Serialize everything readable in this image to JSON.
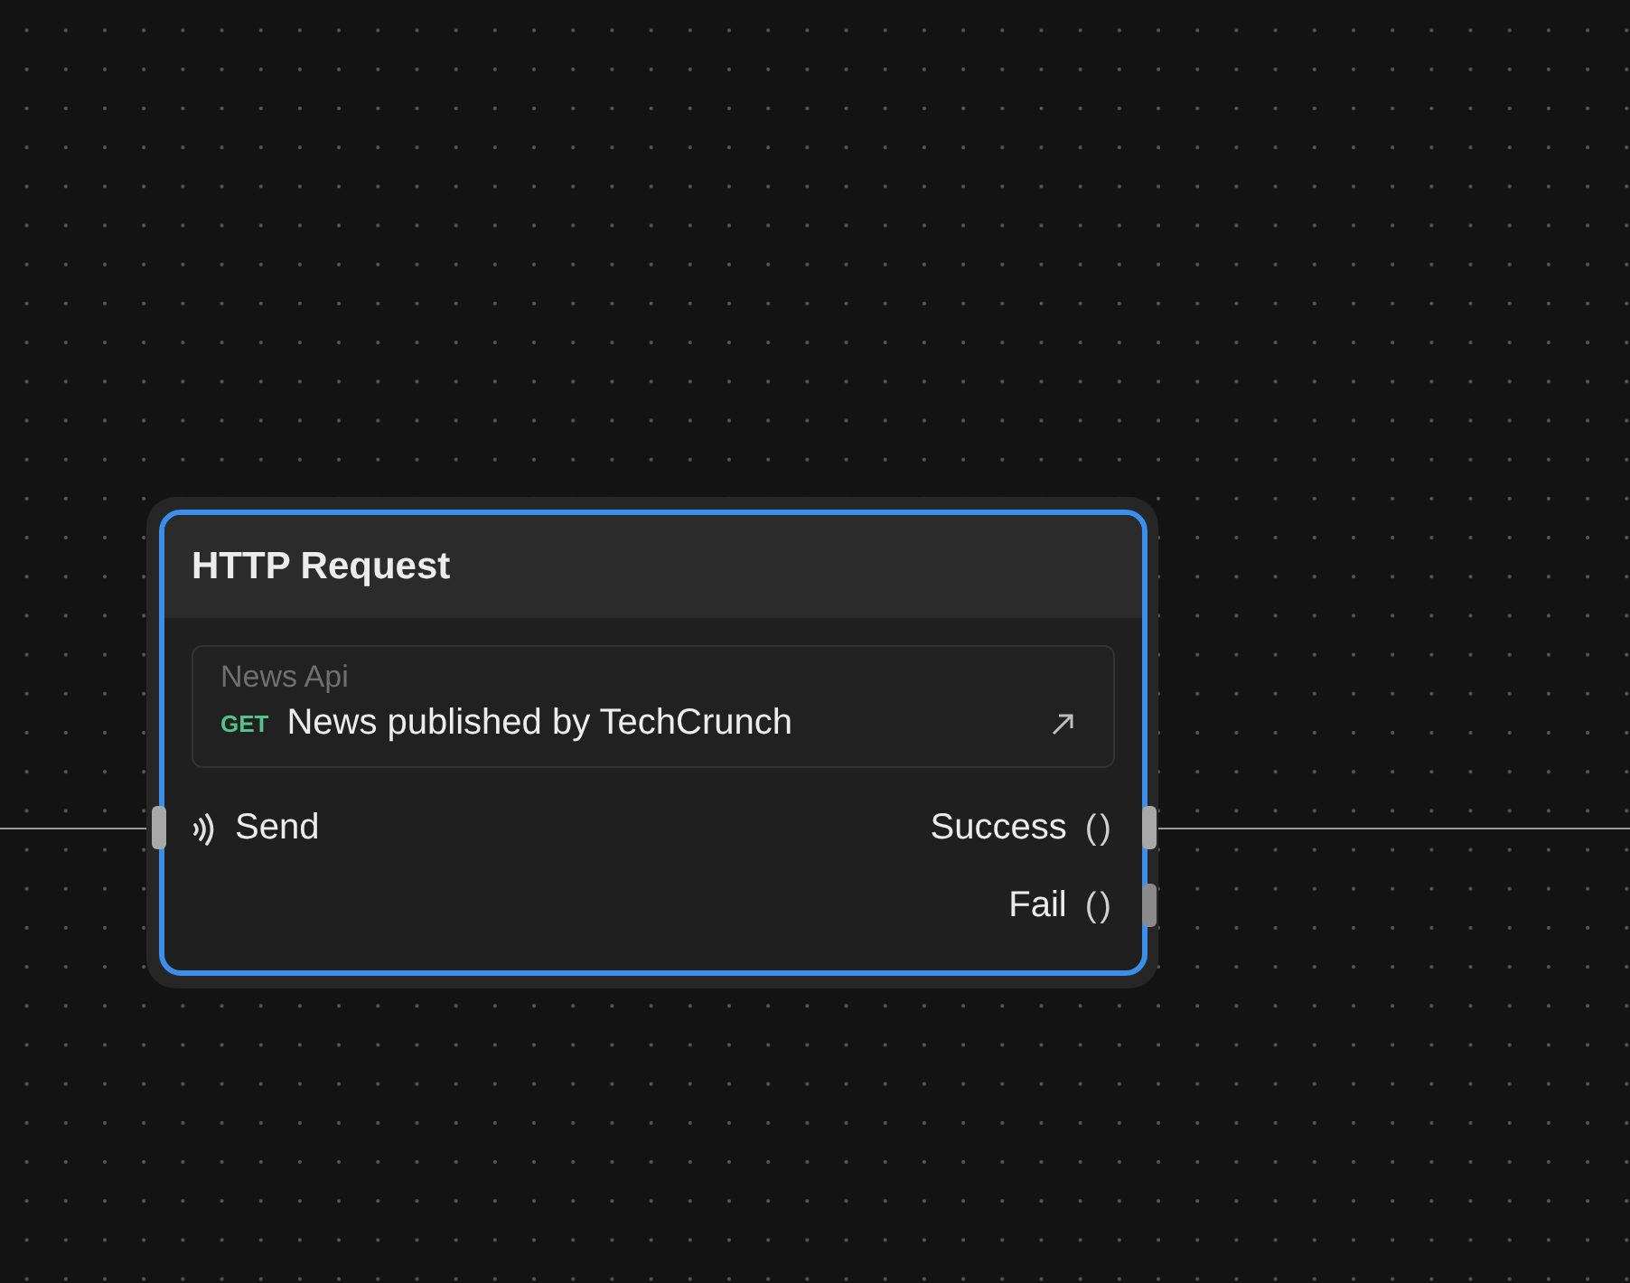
{
  "node": {
    "title": "HTTP Request",
    "selected": true,
    "request": {
      "source": "News Api",
      "method": "GET",
      "name": "News published by TechCrunch"
    },
    "inputs": [
      {
        "label": "Send",
        "connected": true
      }
    ],
    "outputs": [
      {
        "label": "Success",
        "symbol": "()",
        "connected": true
      },
      {
        "label": "Fail",
        "symbol": "()",
        "connected": false
      }
    ]
  }
}
